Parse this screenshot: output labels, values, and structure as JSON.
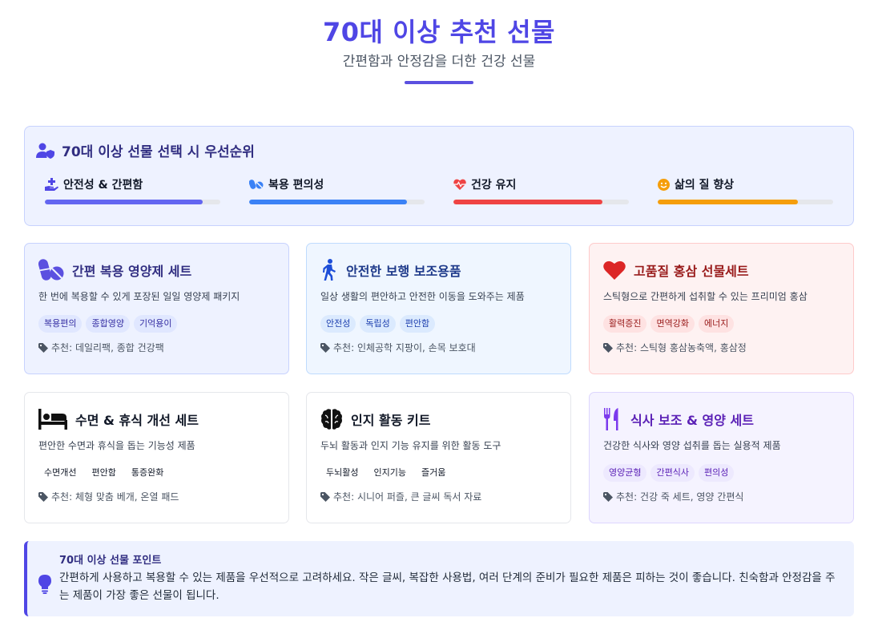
{
  "header": {
    "title": "70대 이상 추천 선물",
    "subtitle": "간편함과 안정감을 더한 건강 선물"
  },
  "priorities": {
    "title": "70대 이상 선물 선택 시 우선순위",
    "items": [
      {
        "label": "안전성 & 간편함",
        "level": 0.9,
        "color": "#6366f1",
        "icon": "hand-plus-icon"
      },
      {
        "label": "복용 편의성",
        "level": 0.9,
        "color": "#3b82f6",
        "icon": "pills-icon"
      },
      {
        "label": "건강 유지",
        "level": 0.85,
        "color": "#ef4444",
        "icon": "heart-pulse-icon"
      },
      {
        "label": "삶의 질 향상",
        "level": 0.8,
        "color": "#f59e0b",
        "icon": "smile-icon"
      }
    ]
  },
  "cards": [
    {
      "title": "간편 복용 영양제 세트",
      "desc": "한 번에 복용할 수 있게 포장된 일일 영양제 패키지",
      "tags": [
        "복용편의",
        "종합영양",
        "기억용이"
      ],
      "rec": "추천: 데일리팩, 종합 건강팩",
      "icon": "pills-icon"
    },
    {
      "title": "안전한 보행 보조용품",
      "desc": "일상 생활의 편안하고 안전한 이동을 도와주는 제품",
      "tags": [
        "안전성",
        "독립성",
        "편안함"
      ],
      "rec": "추천: 인체공학 지팡이, 손목 보호대",
      "icon": "walking-icon"
    },
    {
      "title": "고품질 홍삼 선물세트",
      "desc": "스틱형으로 간편하게 섭취할 수 있는 프리미엄 홍삼",
      "tags": [
        "활력증진",
        "면역강화",
        "에너지"
      ],
      "rec": "추천: 스틱형 홍삼농축액, 홍삼정",
      "icon": "heart-icon"
    },
    {
      "title": "수면 & 휴식 개선 세트",
      "desc": "편안한 수면과 휴식을 돕는 기능성 제품",
      "tags": [
        "수면개선",
        "편안함",
        "통증완화"
      ],
      "rec": "추천: 체형 맞춤 베개, 온열 패드",
      "icon": "bed-icon"
    },
    {
      "title": "인지 활동 키트",
      "desc": "두뇌 활동과 인지 기능 유지를 위한 활동 도구",
      "tags": [
        "두뇌활성",
        "인지기능",
        "즐거움"
      ],
      "rec": "추천: 시니어 퍼즐, 큰 글씨 독서 자료",
      "icon": "brain-icon"
    },
    {
      "title": "식사 보조 & 영양 세트",
      "desc": "건강한 식사와 영양 섭취를 돕는 실용적 제품",
      "tags": [
        "영양균형",
        "간편식사",
        "편의성"
      ],
      "rec": "추천: 건강 죽 세트, 영양 간편식",
      "icon": "utensils-icon"
    }
  ],
  "tip": {
    "title": "70대 이상 선물 포인트",
    "body": "간편하게 사용하고 복용할 수 있는 제품을 우선적으로 고려하세요. 작은 글씨, 복잡한 사용법, 여러 단계의 준비가 필요한 제품은 피하는 것이 좋습니다. 친숙함과 안정감을 주는 제품이 가장 좋은 선물이 됩니다."
  },
  "colors": {
    "accent": "#4f46e5",
    "purple": "#6d28d9",
    "blue": "#1d4ed8",
    "red": "#dc2626"
  }
}
